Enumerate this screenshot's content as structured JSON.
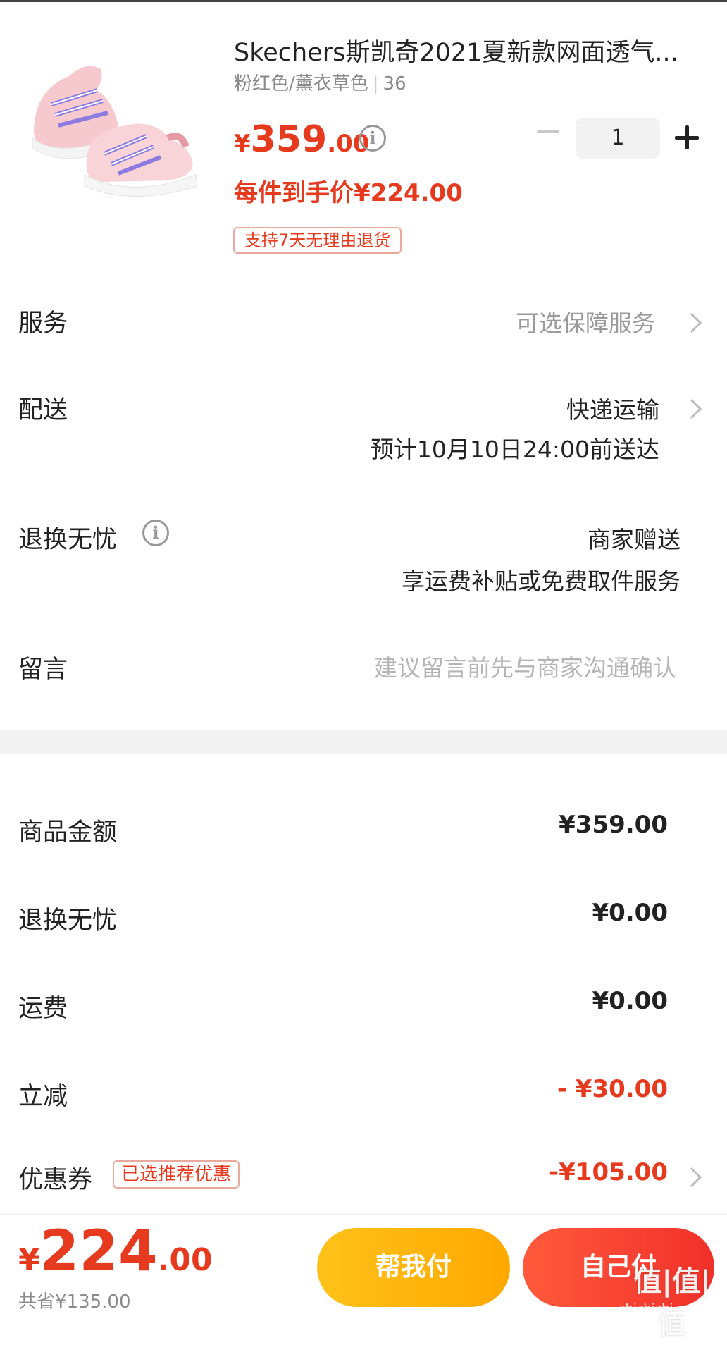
{
  "product": {
    "title": "Skechers斯凯奇2021夏新款网面透气...",
    "spec": "粉红色/薰衣草色",
    "size": "36",
    "price_symbol": "¥",
    "price_int": "359",
    "price_dec": ".00",
    "unit_price": "每件到手价¥224.00",
    "return_tag": "支持7天无理由退货",
    "quantity": "1"
  },
  "rows": {
    "service_label": "服务",
    "service_value": "可选保障服务",
    "delivery_label": "配送",
    "delivery_value": "快递运输",
    "delivery_eta": "预计10月10日24:00前送达",
    "return_label": "退换无忧",
    "return_value": "商家赠送",
    "return_desc": "享运费补贴或免费取件服务",
    "message_label": "留言",
    "message_placeholder": "建议留言前先与商家沟通确认"
  },
  "summary": {
    "goods_label": "商品金额",
    "goods_value": "¥359.00",
    "return_label": "退换无忧",
    "return_value": "¥0.00",
    "shipping_label": "运费",
    "shipping_value": "¥0.00",
    "discount_label": "立减",
    "discount_value": "- ¥30.00",
    "coupon_label": "优惠券",
    "coupon_tag": "已选推荐优惠",
    "coupon_value": "-¥105.00"
  },
  "footer": {
    "total_symbol": "¥",
    "total_int": "224",
    "total_dec": ".00",
    "saved": "共省¥135.00",
    "help_pay": "帮我付",
    "self_pay": "自己付",
    "watermark": "值|值|值",
    "watermark_site": "zhizhizhi.com"
  },
  "colors": {
    "accent_red": "#e63a1e",
    "help_button": "#ffb300",
    "pay_button": "#f0302a"
  }
}
